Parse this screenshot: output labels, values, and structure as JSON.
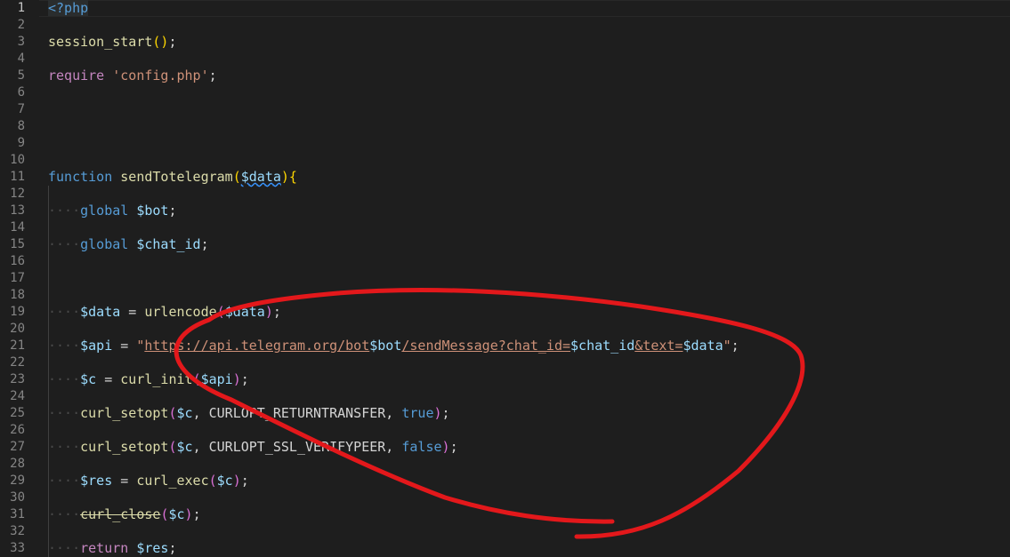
{
  "editor": {
    "active_line": 1,
    "line_numbers": [
      "1",
      "2",
      "3",
      "4",
      "5",
      "6",
      "7",
      "8",
      "9",
      "10",
      "11",
      "12",
      "13",
      "14",
      "15",
      "16",
      "17",
      "18",
      "19",
      "20",
      "21",
      "22",
      "23",
      "24",
      "25",
      "26",
      "27",
      "28",
      "29",
      "30",
      "31",
      "32",
      "33"
    ],
    "lines": [
      {
        "n": 1,
        "tokens": [
          [
            "kw",
            "<?php"
          ]
        ]
      },
      {
        "n": 3,
        "tokens": [
          [
            "fn",
            "session_start"
          ],
          [
            "brk",
            "()"
          ],
          [
            "plain",
            ";"
          ]
        ]
      },
      {
        "n": 5,
        "tokens": [
          [
            "ctl",
            "require"
          ],
          [
            "plain",
            " "
          ],
          [
            "str",
            "'config.php'"
          ],
          [
            "plain",
            ";"
          ]
        ]
      },
      {
        "n": 11,
        "tokens": [
          [
            "kw",
            "function"
          ],
          [
            "plain",
            " "
          ],
          [
            "fn",
            "sendTotelegram"
          ],
          [
            "brk",
            "("
          ],
          [
            "var squig",
            "$data"
          ],
          [
            "brk",
            "){"
          ]
        ]
      },
      {
        "n": 13,
        "indent": true,
        "tokens": [
          [
            "kw",
            "global"
          ],
          [
            "plain",
            " "
          ],
          [
            "var",
            "$bot"
          ],
          [
            "plain",
            ";"
          ]
        ]
      },
      {
        "n": 15,
        "indent": true,
        "tokens": [
          [
            "kw",
            "global"
          ],
          [
            "plain",
            " "
          ],
          [
            "var",
            "$chat_id"
          ],
          [
            "plain",
            ";"
          ]
        ]
      },
      {
        "n": 19,
        "indent": true,
        "tokens": [
          [
            "var",
            "$data"
          ],
          [
            "plain",
            " = "
          ],
          [
            "fn",
            "urlencode"
          ],
          [
            "brk2",
            "("
          ],
          [
            "var",
            "$data"
          ],
          [
            "brk2",
            ")"
          ],
          [
            "plain",
            ";"
          ]
        ]
      },
      {
        "n": 21,
        "indent": true,
        "tokens": [
          [
            "var",
            "$api"
          ],
          [
            "plain",
            " = "
          ],
          [
            "str",
            "\""
          ],
          [
            "url",
            "https://api.telegram.org/bot"
          ],
          [
            "var",
            "$bot"
          ],
          [
            "url",
            "/sendMessage?chat_id="
          ],
          [
            "var",
            "$chat_id"
          ],
          [
            "url",
            "&text="
          ],
          [
            "var",
            "$data"
          ],
          [
            "str",
            "\""
          ],
          [
            "plain",
            ";"
          ]
        ]
      },
      {
        "n": 23,
        "indent": true,
        "tokens": [
          [
            "var",
            "$c"
          ],
          [
            "plain",
            " = "
          ],
          [
            "fn",
            "curl_init"
          ],
          [
            "brk2",
            "("
          ],
          [
            "var",
            "$api"
          ],
          [
            "brk2",
            ")"
          ],
          [
            "plain",
            ";"
          ]
        ]
      },
      {
        "n": 25,
        "indent": true,
        "tokens": [
          [
            "fn",
            "curl_setopt"
          ],
          [
            "brk2",
            "("
          ],
          [
            "var",
            "$c"
          ],
          [
            "plain",
            ", CURLOPT_RETURNTRANSFER, "
          ],
          [
            "kw",
            "true"
          ],
          [
            "brk2",
            ")"
          ],
          [
            "plain",
            ";"
          ]
        ]
      },
      {
        "n": 27,
        "indent": true,
        "tokens": [
          [
            "fn",
            "curl_setopt"
          ],
          [
            "brk2",
            "("
          ],
          [
            "var",
            "$c"
          ],
          [
            "plain",
            ", CURLOPT_SSL_VERIFYPEER, "
          ],
          [
            "kw",
            "false"
          ],
          [
            "brk2",
            ")"
          ],
          [
            "plain",
            ";"
          ]
        ]
      },
      {
        "n": 29,
        "indent": true,
        "tokens": [
          [
            "var",
            "$res"
          ],
          [
            "plain",
            " = "
          ],
          [
            "fn",
            "curl_exec"
          ],
          [
            "brk2",
            "("
          ],
          [
            "var",
            "$c"
          ],
          [
            "brk2",
            ")"
          ],
          [
            "plain",
            ";"
          ]
        ]
      },
      {
        "n": 31,
        "indent": true,
        "tokens": [
          [
            "fn strike",
            "curl_close"
          ],
          [
            "brk2",
            "("
          ],
          [
            "var",
            "$c"
          ],
          [
            "brk2",
            ")"
          ],
          [
            "plain",
            ";"
          ]
        ]
      },
      {
        "n": 33,
        "indent": true,
        "tokens": [
          [
            "ctl",
            "return"
          ],
          [
            "plain",
            " "
          ],
          [
            "var",
            "$res"
          ],
          [
            "plain",
            ";"
          ]
        ]
      }
    ],
    "colors": {
      "background": "#1e1e1e",
      "annotation": "#e3181b"
    }
  }
}
